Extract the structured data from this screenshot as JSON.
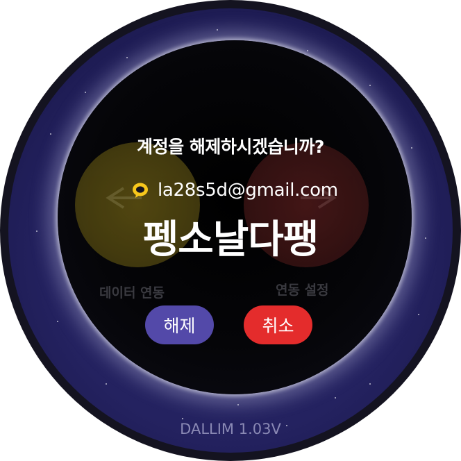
{
  "dialog": {
    "title": "계정을 해제하시겠습니까?",
    "account_icon": "kakao-talk-icon",
    "email": "la28s5d@gmail.com",
    "nickname": "펭소날다팽",
    "confirm_label": "해제",
    "cancel_label": "취소"
  },
  "background_menu": {
    "left_label": "데이터 연동",
    "right_label": "연동 설정"
  },
  "footer": {
    "version": "DALLIM 1.03V"
  },
  "colors": {
    "confirm_button": "#5349a9",
    "cancel_button": "#e42c2c",
    "kakao_yellow": "#f7c71c",
    "bezel": "#242260"
  }
}
